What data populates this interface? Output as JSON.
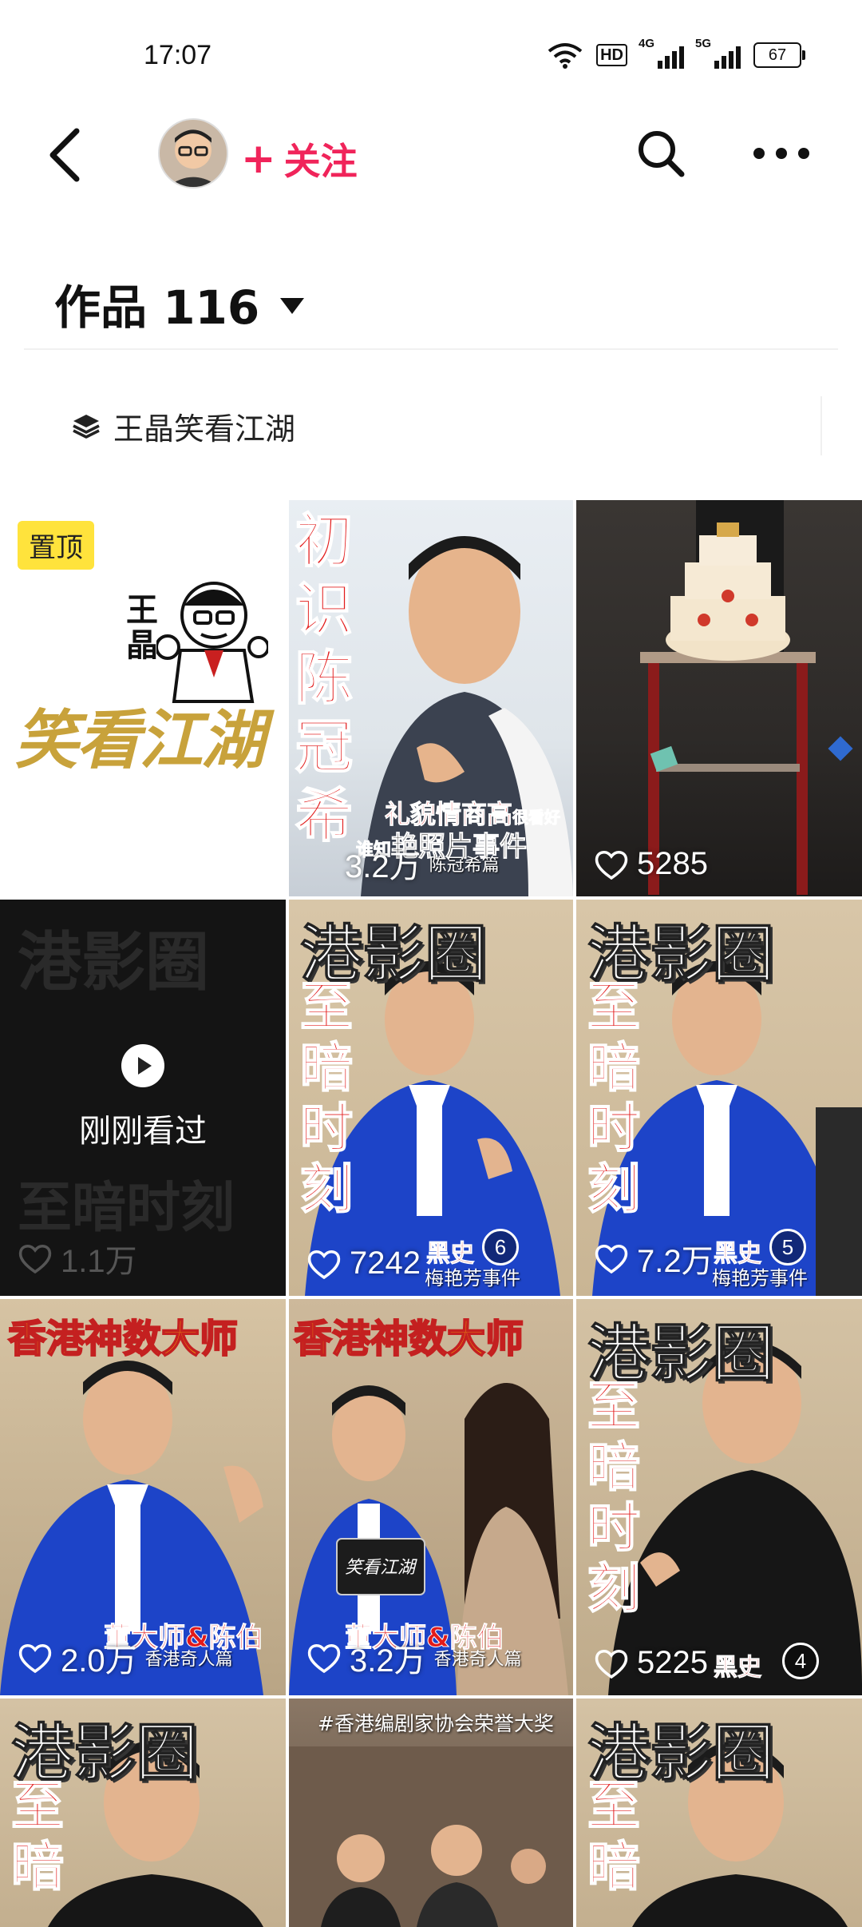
{
  "status_bar": {
    "time": "17:07",
    "hd": "HD",
    "net1": "4G",
    "net2": "5G",
    "battery": "67"
  },
  "header": {
    "follow_label": "关注"
  },
  "works_tab": {
    "label": "作品 116"
  },
  "collection": {
    "label": "王晶笑看江湖"
  },
  "tiles": [
    {
      "pin": "置顶",
      "logo_small": "王晶",
      "logo_big": "笑看江湖"
    },
    {
      "title": "初识陈冠希",
      "sub1": "礼貌情商高",
      "sub1_small": "很看好",
      "sub2_prefix": "谁知",
      "sub2": "艳照片事件",
      "episode_text": "陈冠希篇",
      "views": "3.2万"
    },
    {
      "likes": "5285"
    },
    {
      "title": "港影圈",
      "sub": "至暗时刻",
      "watched": "刚刚看过",
      "likes": "1.1万"
    },
    {
      "title": "港影圈",
      "vertical": "至暗时刻",
      "tag": "梅艳芳事件",
      "tag2": "黑史",
      "likes": "7242",
      "ep": "6"
    },
    {
      "title": "港影圈",
      "vertical": "至暗时刻",
      "tag": "梅艳芳事件",
      "tag2": "黑史",
      "likes": "7.2万",
      "ep": "5"
    },
    {
      "title": "香港神数大师",
      "names": "董大师&陈伯",
      "episode_text": "香港奇人篇",
      "likes": "2.0万"
    },
    {
      "title": "香港神数大师",
      "names": "董大师&陈伯",
      "episode_text": "香港奇人篇",
      "likes": "3.2万",
      "card": "笑看江湖"
    },
    {
      "title": "港影圈",
      "vertical": "至暗时刻",
      "tag2": "黑史",
      "likes": "5225",
      "ep": "4"
    },
    {
      "title": "港影圈",
      "vertical": "至暗"
    },
    {
      "hashtag": "#香港编剧家协会荣誉大奖"
    },
    {
      "title": "港影圈",
      "vertical": "至暗"
    }
  ],
  "colors": {
    "accent": "#f0245a",
    "pin": "#ffe33c",
    "blue_suit": "#1d44c8",
    "red_title": "#e21b1b"
  }
}
